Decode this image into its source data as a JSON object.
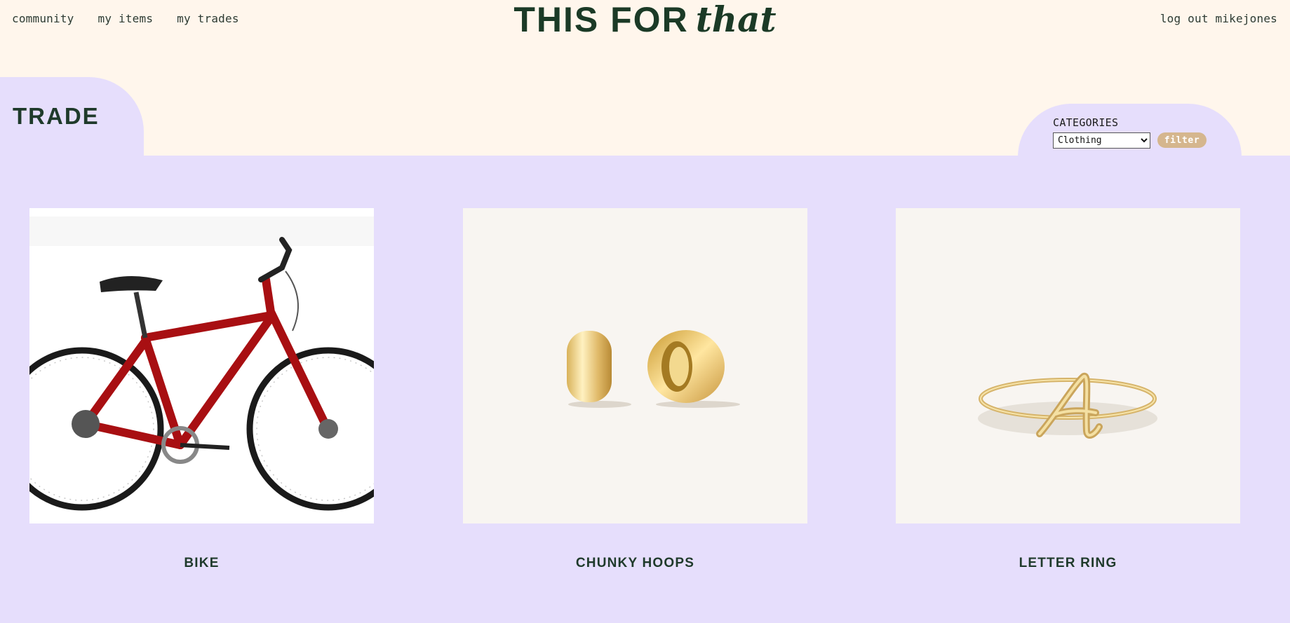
{
  "nav": {
    "left": [
      "community",
      "my items",
      "my trades"
    ],
    "logout": "log out mikejones"
  },
  "brand": {
    "part1": "THIS FOR",
    "part2": "that",
    "color": "#1b3a26"
  },
  "page_title": "TRADE",
  "filter": {
    "label": "CATEGORIES",
    "selected": "Clothing",
    "button": "filter",
    "button_color": "#d5b68e"
  },
  "colors": {
    "background": "#fff6ec",
    "panel": "#e6defc",
    "text": "#1f3a2b"
  },
  "items": [
    {
      "name": "BIKE",
      "image": "bike-photo"
    },
    {
      "name": "CHUNKY HOOPS",
      "image": "earrings-photo"
    },
    {
      "name": "LETTER RING",
      "image": "ring-photo"
    }
  ]
}
